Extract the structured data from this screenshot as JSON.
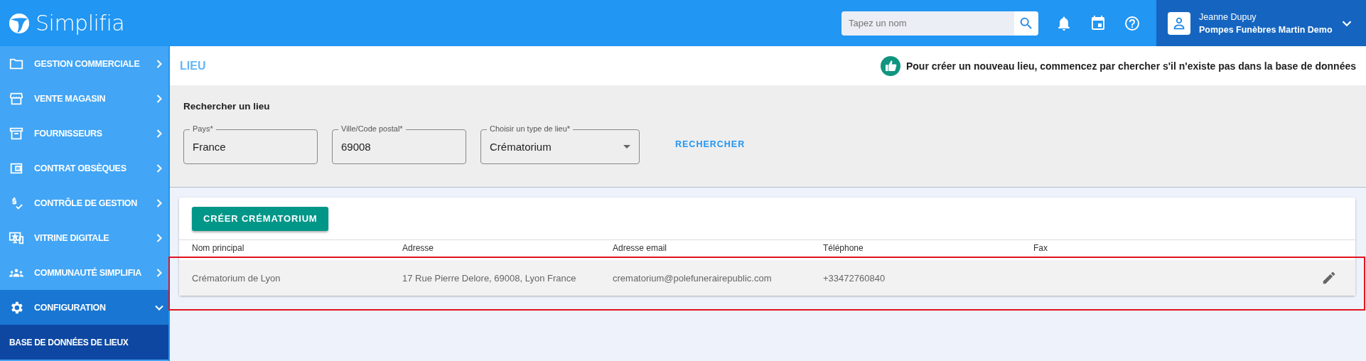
{
  "header": {
    "logo": "Simplifia",
    "search": {
      "placeholder": "Tapez un nom"
    },
    "user": {
      "name": "Jeanne Dupuy",
      "company": "Pompes Funèbres Martin Demo"
    }
  },
  "sidebar": {
    "items": [
      {
        "label": "GESTION COMMERCIALE",
        "expanded": false,
        "selected": false
      },
      {
        "label": "VENTE MAGASIN",
        "expanded": false,
        "selected": false
      },
      {
        "label": "FOURNISSEURS",
        "expanded": false,
        "selected": false
      },
      {
        "label": "CONTRAT OBSÈQUES",
        "expanded": false,
        "selected": false
      },
      {
        "label": "CONTRÔLE DE GESTION",
        "expanded": false,
        "selected": false
      },
      {
        "label": "VITRINE DIGITALE",
        "expanded": false,
        "selected": false
      },
      {
        "label": "COMMUNAUTÉ SIMPLIFIA",
        "expanded": false,
        "selected": false
      },
      {
        "label": "CONFIGURATION",
        "expanded": true,
        "selected": true,
        "children": [
          {
            "label": "BASE DE DONNÉES DE LIEUX",
            "selected": true
          }
        ]
      }
    ]
  },
  "page": {
    "title": "LIEU",
    "hint": "Pour créer un nouveau lieu, commencez par chercher s'il n'existe pas dans la base de données"
  },
  "search_form": {
    "title": "Rechercher un lieu",
    "fields": [
      {
        "label": "Pays*",
        "value": "France",
        "kind": "text"
      },
      {
        "label": "Ville/Code postal*",
        "value": "69008",
        "kind": "text"
      },
      {
        "label": "Choisir un type de lieu*",
        "value": "Crématorium",
        "kind": "select"
      }
    ],
    "button": "RECHERCHER"
  },
  "create_button": "CRÉER CRÉMATORIUM",
  "table": {
    "columns": [
      "Nom principal",
      "Adresse",
      "Adresse email",
      "Téléphone",
      "Fax"
    ],
    "rows": [
      {
        "cells": [
          "Crématorium de Lyon",
          "17 Rue Pierre Delore, 69008, Lyon France",
          "crematorium@polefunerairepublic.com",
          "+33472760840",
          ""
        ],
        "highlighted": true
      }
    ]
  }
}
